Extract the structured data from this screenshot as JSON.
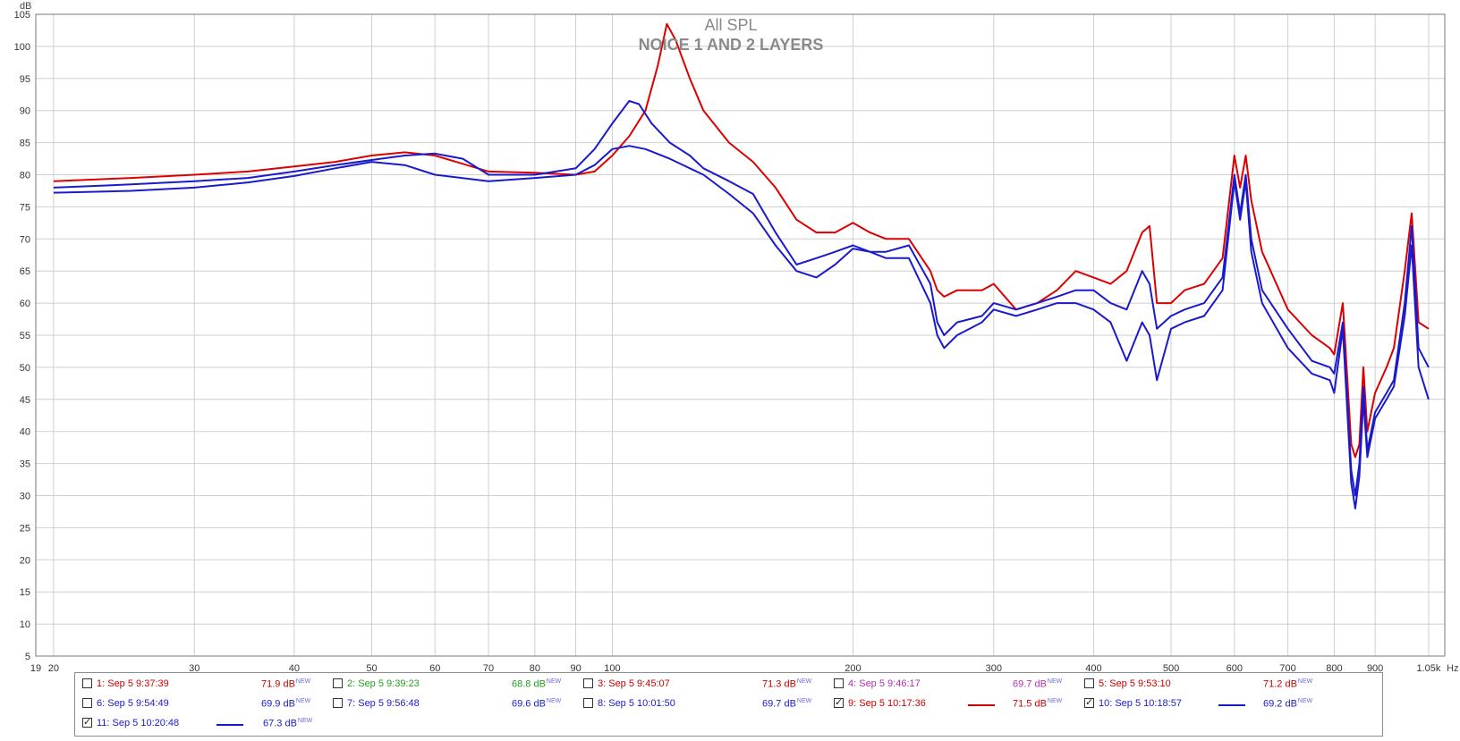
{
  "chart_data": {
    "type": "line",
    "title": "All SPL",
    "subtitle": "NOICE 1 AND 2 LAYERS",
    "ylabel": "dB",
    "xunit": "Hz",
    "xscale": "log",
    "xlim": [
      19,
      1100
    ],
    "ylim": [
      5,
      105
    ],
    "y_ticks": [
      5,
      10,
      15,
      20,
      25,
      30,
      35,
      40,
      45,
      50,
      55,
      60,
      65,
      70,
      75,
      80,
      85,
      90,
      95,
      100,
      105
    ],
    "x_ticks": [
      {
        "value": 19,
        "label": "19"
      },
      {
        "value": 20,
        "label": "20"
      },
      {
        "value": 30,
        "label": "30"
      },
      {
        "value": 40,
        "label": "40"
      },
      {
        "value": 50,
        "label": "50"
      },
      {
        "value": 60,
        "label": "60"
      },
      {
        "value": 70,
        "label": "70"
      },
      {
        "value": 80,
        "label": "80"
      },
      {
        "value": 90,
        "label": "90"
      },
      {
        "value": 100,
        "label": "100"
      },
      {
        "value": 200,
        "label": "200"
      },
      {
        "value": 300,
        "label": "300"
      },
      {
        "value": 400,
        "label": "400"
      },
      {
        "value": 500,
        "label": "500"
      },
      {
        "value": 600,
        "label": "600"
      },
      {
        "value": 700,
        "label": "700"
      },
      {
        "value": 800,
        "label": "800"
      },
      {
        "value": 900,
        "label": "900"
      },
      {
        "value": 1050,
        "label": "1.05k"
      }
    ],
    "grid": true,
    "series": [
      {
        "name": "9: Sep 5 10:17:36",
        "color": "#dd0000",
        "x": [
          20,
          25,
          30,
          35,
          40,
          45,
          50,
          55,
          60,
          70,
          80,
          90,
          95,
          100,
          105,
          110,
          114,
          117,
          120,
          125,
          130,
          140,
          150,
          160,
          170,
          180,
          190,
          200,
          210,
          220,
          235,
          250,
          255,
          260,
          270,
          290,
          300,
          320,
          340,
          360,
          380,
          400,
          420,
          440,
          460,
          470,
          480,
          500,
          520,
          550,
          580,
          600,
          610,
          620,
          630,
          650,
          700,
          750,
          790,
          800,
          820,
          840,
          850,
          860,
          870,
          880,
          900,
          930,
          950,
          980,
          1000,
          1020,
          1050
        ],
        "y": [
          79,
          79.5,
          80,
          80.5,
          81.3,
          82,
          83,
          83.5,
          83,
          80.5,
          80.3,
          80,
          80.5,
          83,
          86,
          90,
          97,
          103.5,
          101,
          95,
          90,
          85,
          82,
          78,
          73,
          71,
          71,
          72.5,
          71,
          70,
          70,
          65,
          62,
          61,
          62,
          62,
          63,
          59,
          60,
          62,
          65,
          64,
          63,
          65,
          71,
          72,
          60,
          60,
          62,
          63,
          67,
          83,
          78,
          83,
          76,
          68,
          59,
          55,
          53,
          52,
          60,
          38,
          36,
          38,
          50,
          40,
          46,
          50,
          53,
          65,
          74,
          57,
          56
        ]
      },
      {
        "name": "10: Sep 5 10:18:57",
        "color": "#1a1acc",
        "x": [
          20,
          25,
          30,
          35,
          40,
          45,
          50,
          55,
          60,
          65,
          70,
          80,
          90,
          95,
          100,
          105,
          108,
          112,
          118,
          125,
          130,
          140,
          150,
          160,
          170,
          180,
          190,
          200,
          210,
          220,
          235,
          250,
          255,
          260,
          270,
          290,
          300,
          320,
          340,
          360,
          380,
          400,
          420,
          440,
          460,
          470,
          480,
          500,
          520,
          550,
          580,
          600,
          610,
          620,
          630,
          650,
          700,
          750,
          790,
          800,
          820,
          840,
          850,
          860,
          870,
          880,
          900,
          930,
          950,
          980,
          1000,
          1020,
          1050
        ],
        "y": [
          78,
          78.5,
          79,
          79.5,
          80.5,
          81.5,
          82.3,
          83,
          83.3,
          82.5,
          80,
          80,
          81,
          84,
          88,
          91.5,
          91,
          88,
          85,
          83,
          81,
          79,
          77,
          71,
          66,
          67,
          68,
          69,
          68,
          68,
          69,
          63,
          57,
          55,
          57,
          58,
          60,
          59,
          60,
          61,
          62,
          62,
          60,
          59,
          65,
          63,
          56,
          58,
          59,
          60,
          64,
          80,
          74,
          80,
          70,
          62,
          56,
          51,
          50,
          49,
          57,
          34,
          30,
          35,
          47,
          37,
          43,
          46,
          48,
          60,
          72,
          53,
          50
        ]
      },
      {
        "name": "11: Sep 5 10:20:48",
        "color": "#1a1acc",
        "x": [
          20,
          25,
          30,
          35,
          40,
          45,
          50,
          55,
          60,
          70,
          80,
          90,
          95,
          100,
          105,
          110,
          118,
          125,
          130,
          140,
          150,
          160,
          170,
          180,
          190,
          200,
          210,
          220,
          235,
          250,
          255,
          260,
          270,
          290,
          300,
          320,
          340,
          360,
          380,
          400,
          420,
          440,
          460,
          470,
          480,
          500,
          520,
          550,
          580,
          600,
          610,
          620,
          630,
          650,
          700,
          750,
          790,
          800,
          820,
          840,
          850,
          860,
          870,
          880,
          900,
          930,
          950,
          980,
          1000,
          1020,
          1050
        ],
        "y": [
          77.2,
          77.5,
          78,
          78.8,
          79.8,
          81,
          82,
          81.5,
          80,
          79,
          79.5,
          80,
          81.5,
          84,
          84.5,
          84,
          82.5,
          81,
          80,
          77,
          74,
          69,
          65,
          64,
          66,
          68.5,
          68,
          67,
          67,
          60,
          55,
          53,
          55,
          57,
          59,
          58,
          59,
          60,
          60,
          59,
          57,
          51,
          57,
          55,
          48,
          56,
          57,
          58,
          62,
          79,
          73,
          79,
          68,
          60,
          53,
          49,
          48,
          46,
          56,
          32,
          28,
          33,
          45,
          36,
          42,
          45,
          47,
          58,
          69,
          50,
          45
        ]
      }
    ]
  },
  "legend": {
    "items": [
      {
        "label": "1: Sep 5 9:37:39",
        "color": "#cc0000",
        "level": "71.9 dB",
        "checked": false
      },
      {
        "label": "2: Sep 5 9:39:23",
        "color": "#22a022",
        "level": "68.8 dB",
        "checked": false
      },
      {
        "label": "3: Sep 5 9:45:07",
        "color": "#cc0000",
        "level": "71.3 dB",
        "checked": false
      },
      {
        "label": "4: Sep 5 9:46:17",
        "color": "#b030b0",
        "level": "69.7 dB",
        "checked": false
      },
      {
        "label": "5: Sep 5 9:53:10",
        "color": "#cc0000",
        "level": "71.2 dB",
        "checked": false
      },
      {
        "label": "6: Sep 5 9:54:49",
        "color": "#1a1acc",
        "level": "69.9 dB",
        "checked": false
      },
      {
        "label": "7: Sep 5 9:56:48",
        "color": "#1a1acc",
        "level": "69.6 dB",
        "checked": false
      },
      {
        "label": "8: Sep 5 10:01:50",
        "color": "#1a1acc",
        "level": "69.7 dB",
        "checked": false
      },
      {
        "label": "9: Sep 5 10:17:36",
        "color": "#cc0000",
        "level": "71.5 dB",
        "checked": true
      },
      {
        "label": "10: Sep 5 10:18:57",
        "color": "#1a1acc",
        "level": "69.2 dB",
        "checked": true
      },
      {
        "label": "11: Sep 5 10:20:48",
        "color": "#1a1acc",
        "level": "67.3 dB",
        "checked": true
      }
    ],
    "new_tag": "NEW",
    "new_tag_color": "#6a6ad8"
  }
}
